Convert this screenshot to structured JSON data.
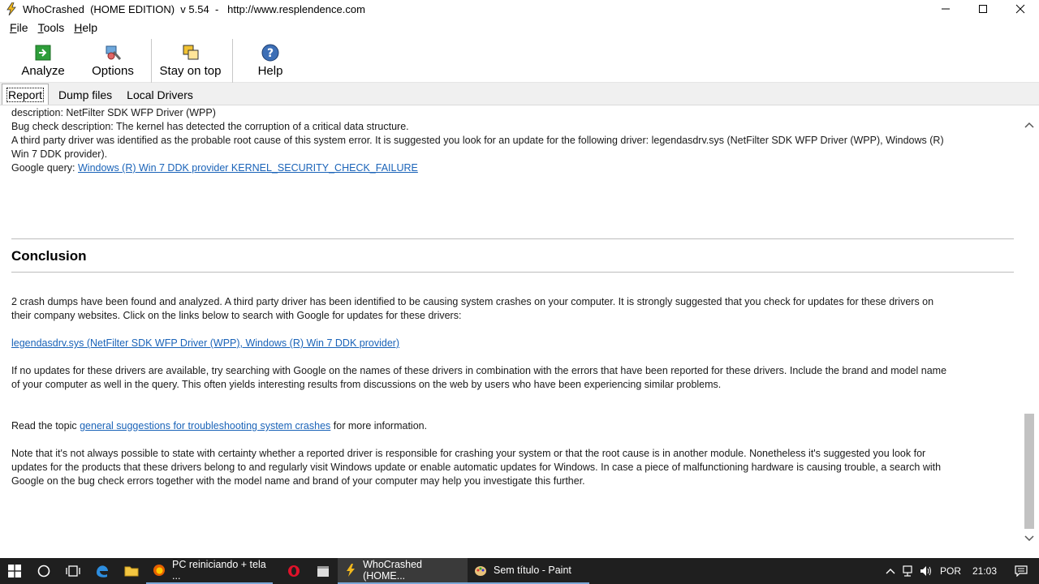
{
  "window": {
    "title": "WhoCrashed  (HOME EDITION)  v 5.54  -   http://www.resplendence.com"
  },
  "menu": {
    "items": [
      {
        "first": "F",
        "rest": "ile"
      },
      {
        "first": "T",
        "rest": "ools"
      },
      {
        "first": "H",
        "rest": "elp"
      }
    ]
  },
  "toolbar": {
    "analyze_label": "Analyze",
    "options_label": "Options",
    "stay_on_top_label": "Stay on top",
    "help_label": "Help"
  },
  "tabs": {
    "report": "Report",
    "dump_files": "Dump files",
    "local_drivers": "Local Drivers"
  },
  "report": {
    "line_description": "description: NetFilter SDK WFP Driver (WPP)",
    "line_bugcheck": "Bug check description: The kernel has detected the corruption of a critical data structure.",
    "line_third_party_1": "A third party driver was identified as the probable root cause of this system error. It is suggested you look for an update for the following driver: legendasdrv.sys (NetFilter SDK WFP Driver (WPP), Windows (R)",
    "line_third_party_2": "Win 7 DDK provider).",
    "google_query_label": "Google query: ",
    "google_query_link": "Windows (R) Win 7 DDK provider KERNEL_SECURITY_CHECK_FAILURE",
    "conclusion_heading": "Conclusion",
    "conclusion_p1_1": "2 crash dumps have been found and analyzed. A third party driver has been identified to be causing system crashes on your computer. It is strongly suggested that you check for updates for these drivers on",
    "conclusion_p1_2": "their company websites. Click on the links below to search with Google for updates for these drivers:",
    "driver_link": "legendasdrv.sys (NetFilter SDK WFP Driver (WPP), Windows (R) Win 7 DDK provider)",
    "conclusion_p2_1": "If no updates for these drivers are available, try searching with Google on the names of these drivers in combination with the errors that have been reported for these drivers. Include the brand and model name",
    "conclusion_p2_2": "of your computer as well in the query. This often yields interesting results from discussions on the web by users who have been experiencing similar problems.",
    "read_topic_prefix": "Read the topic ",
    "read_topic_link": "general suggestions for troubleshooting system crashes",
    "read_topic_suffix": " for more information.",
    "note_1": "Note that it's not always possible to state with certainty whether a reported driver is responsible for crashing your system or that the root cause is in another module. Nonetheless it's suggested you look for",
    "note_2": "updates for the products that these drivers belong to and regularly visit Windows update or enable automatic updates for Windows. In case a piece of malfunctioning hardware is causing trouble, a search with",
    "note_3": "Google on the bug check errors together with the model name and brand of your computer may help you investigate this further."
  },
  "taskbar": {
    "apps": [
      {
        "label": "PC reiniciando + tela ...",
        "icon": "firefox-icon"
      },
      {
        "label": "WhoCrashed  (HOME...",
        "icon": "whocrashed-icon"
      },
      {
        "label": "Sem título - Paint",
        "icon": "paint-icon"
      }
    ],
    "language": "POR",
    "time": "21:03"
  },
  "colors": {
    "link": "#1a63b8",
    "taskbar_bg": "#1f1f1f",
    "taskbar_active": "#3a3a3a"
  }
}
